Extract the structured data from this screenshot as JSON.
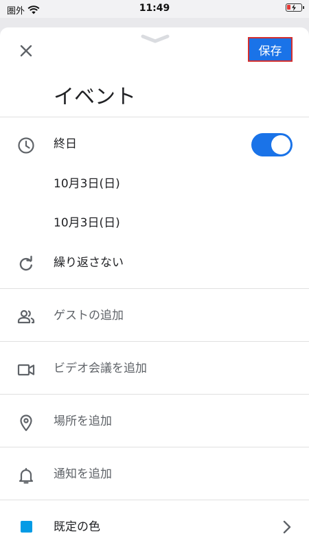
{
  "status_bar": {
    "carrier": "圏外",
    "time": "11:49"
  },
  "header": {
    "save_label": "保存",
    "title": "イベント"
  },
  "all_day": {
    "label": "終日",
    "enabled": true
  },
  "dates": {
    "start": "10月3日(日)",
    "end": "10月3日(日)"
  },
  "repeat": {
    "label": "繰り返さない"
  },
  "options": {
    "guests": "ゲストの追加",
    "video": "ビデオ会議を追加",
    "location": "場所を追加",
    "notification": "通知を追加",
    "color": "既定の色"
  },
  "colors": {
    "accent": "#1a73e8",
    "swatch": "#039be5",
    "save_outline": "#d32f2f"
  }
}
